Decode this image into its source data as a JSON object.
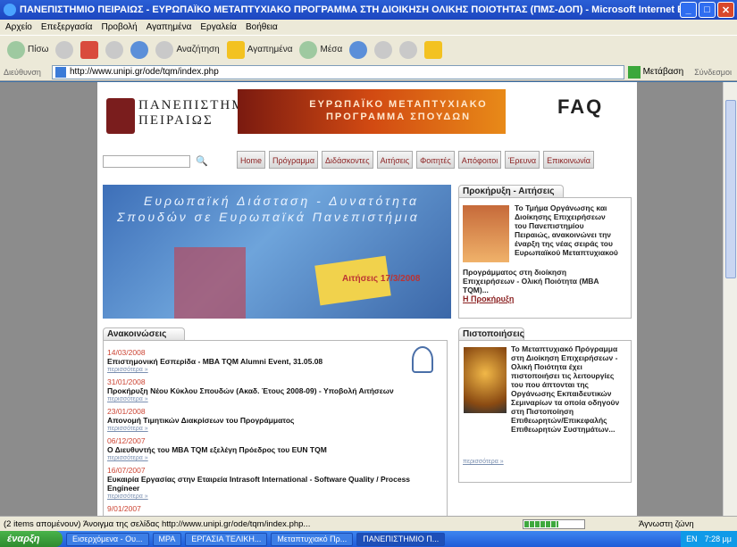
{
  "window": {
    "title": "ΠΑΝΕΠΙΣΤΗΜΙΟ ΠΕΙΡΑΙΩΣ - ΕΥΡΩΠΑΪΚΟ ΜΕΤΑΠΤΥΧΙΑΚΟ ΠΡΟΓΡΑΜΜΑ ΣΤΗ ΔΙΟΙΚΗΣΗ ΟΛΙΚΗΣ ΠΟΙΟΤΗΤΑΣ (ΠΜΣ-ΔΟΠ) - Microsoft Internet Explorer"
  },
  "menu": [
    "Αρχείο",
    "Επεξεργασία",
    "Προβολή",
    "Αγαπημένα",
    "Εργαλεία",
    "Βοήθεια"
  ],
  "toolbar": {
    "back": "Πίσω",
    "search": "Αναζήτηση",
    "favorites": "Αγαπημένα",
    "media": "Μέσα"
  },
  "address": {
    "label": "Διεύθυνση",
    "url": "http://www.unipi.gr/ode/tqm/index.php",
    "go": "Μετάβαση",
    "links": "Σύνδεσμοι"
  },
  "site": {
    "logo_line1": "ΠΑΝΕΠΙΣΤΗΜΙΟ",
    "logo_line2": "ΠΕΙΡΑΙΩΣ",
    "banner_line1": "ΕΥΡΩΠΑΪΚΟ ΜΕΤΑΠΤΥΧΙΑΚΟ",
    "banner_line2": "ΠΡΟΓΡΑΜΜΑ ΣΠΟΥΔΩΝ",
    "faq": "FAQ",
    "nav": [
      "Home",
      "Πρόγραμμα",
      "Διδάσκοντες",
      "Αιτήσεις",
      "Φοιτητές",
      "Απόφοιτοι",
      "Έρευνα",
      "Επικοινωνία"
    ],
    "hero_line1": "Ευρωπαϊκή Διάσταση - Δυνατότητα",
    "hero_line2": "Σπουδών σε Ευρωπαϊκά Πανεπιστήμια",
    "hero_year": "Αιτήσεις 17/3/2008"
  },
  "recruit": {
    "heading": "Προκήρυξη - Αιτήσεις",
    "text_right": "Το Τμήμα Οργάνωσης και Διοίκησης Επιχειρήσεων του Πανεπιστημίου Πειραιώς, ανακοινώνει την έναρξη της νέας σειράς του Ευρωπαϊκού Μεταπτυχιακού",
    "text_bottom": "Προγράμματος στη διοίκηση Επιχειρήσεων - Ολική Ποιότητα (MBA TQM)...",
    "link": "Η Προκήρυξη"
  },
  "announcements": {
    "heading": "Ανακοινώσεις",
    "more": "περισσότερα »",
    "items": [
      {
        "date": "14/03/2008",
        "title": "Επιστημονική Εσπερίδα - MBA TQM Alumni Event, 31.05.08"
      },
      {
        "date": "31/01/2008",
        "title": "Προκήρυξη Νέου Κύκλου Σπουδών (Ακαδ. Έτους 2008-09) - Υποβολή Αιτήσεων"
      },
      {
        "date": "23/01/2008",
        "title": "Απονομή Τιμητικών Διακρίσεων του Προγράμματος"
      },
      {
        "date": "06/12/2007",
        "title": "Ο Διευθυντής του MBA TQM εξελέγη Πρόεδρος του EUN TQM"
      },
      {
        "date": "16/07/2007",
        "title": "Ευκαιρία Εργασίας στην Εταιρεία Intrasoft International - Software Quality / Process Engineer"
      },
      {
        "date": "9/01/2007",
        "title": ""
      }
    ]
  },
  "certification": {
    "heading": "Πιστοποιήσεις",
    "text": "Το Μεταπτυχιακό Πρόγραμμα στη Διοίκηση Επιχειρήσεων - Ολική Ποιότητα έχει πιστοποιήσει τις λειτουργίες του που άπτονται της Οργάνωσης Εκπαιδευτικών Σεμιναρίων τα οποία οδηγούν στη Πιστοποίηση Επιθεωρητών/Επικεφαλής Επιθεωρητών Συστημάτων...",
    "more": "περισσότερα »"
  },
  "status": {
    "text": "(2 items απομένουν) Άνοιγμα της σελίδας http://www.unipi.gr/ode/tqm/index.php...",
    "zone": "Άγνωστη ζώνη"
  },
  "taskbar": {
    "start": "έναρξη",
    "tasks": [
      "Εισερχόμενα - Ου...",
      "MPA",
      "ΕΡΓΑΣΙΑ ΤΕΛΙΚΗ...",
      "Μεταπτυχιακό Πρ...",
      "ΠΑΝΕΠΙΣΤΗΜΙΟ Π..."
    ],
    "lang": "EN",
    "clock": "7:28 μμ"
  }
}
